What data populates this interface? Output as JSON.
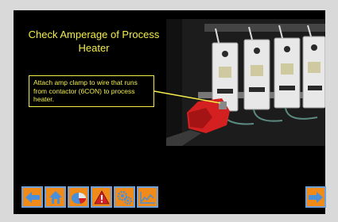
{
  "screen": {
    "title": "Check Amperage of Process Heater",
    "instruction": "Attach amp clamp to wire that runs from contactor (6CON) to process heater."
  },
  "toolbar": {
    "buttons": [
      {
        "name": "back",
        "icon": "left-arrow-icon"
      },
      {
        "name": "home",
        "icon": "home-icon"
      },
      {
        "name": "chart",
        "icon": "pie-chart-icon"
      },
      {
        "name": "warning",
        "icon": "warning-icon"
      },
      {
        "name": "settings",
        "icon": "gears-icon"
      },
      {
        "name": "trend",
        "icon": "line-graph-icon"
      }
    ],
    "next": {
      "name": "next",
      "icon": "right-arrow-icon"
    }
  },
  "colors": {
    "background": "#000000",
    "title_text": "#f4ee4a",
    "button_fill": "#f08a18",
    "button_border": "#6fa0d8",
    "clamp": "#d42020"
  }
}
